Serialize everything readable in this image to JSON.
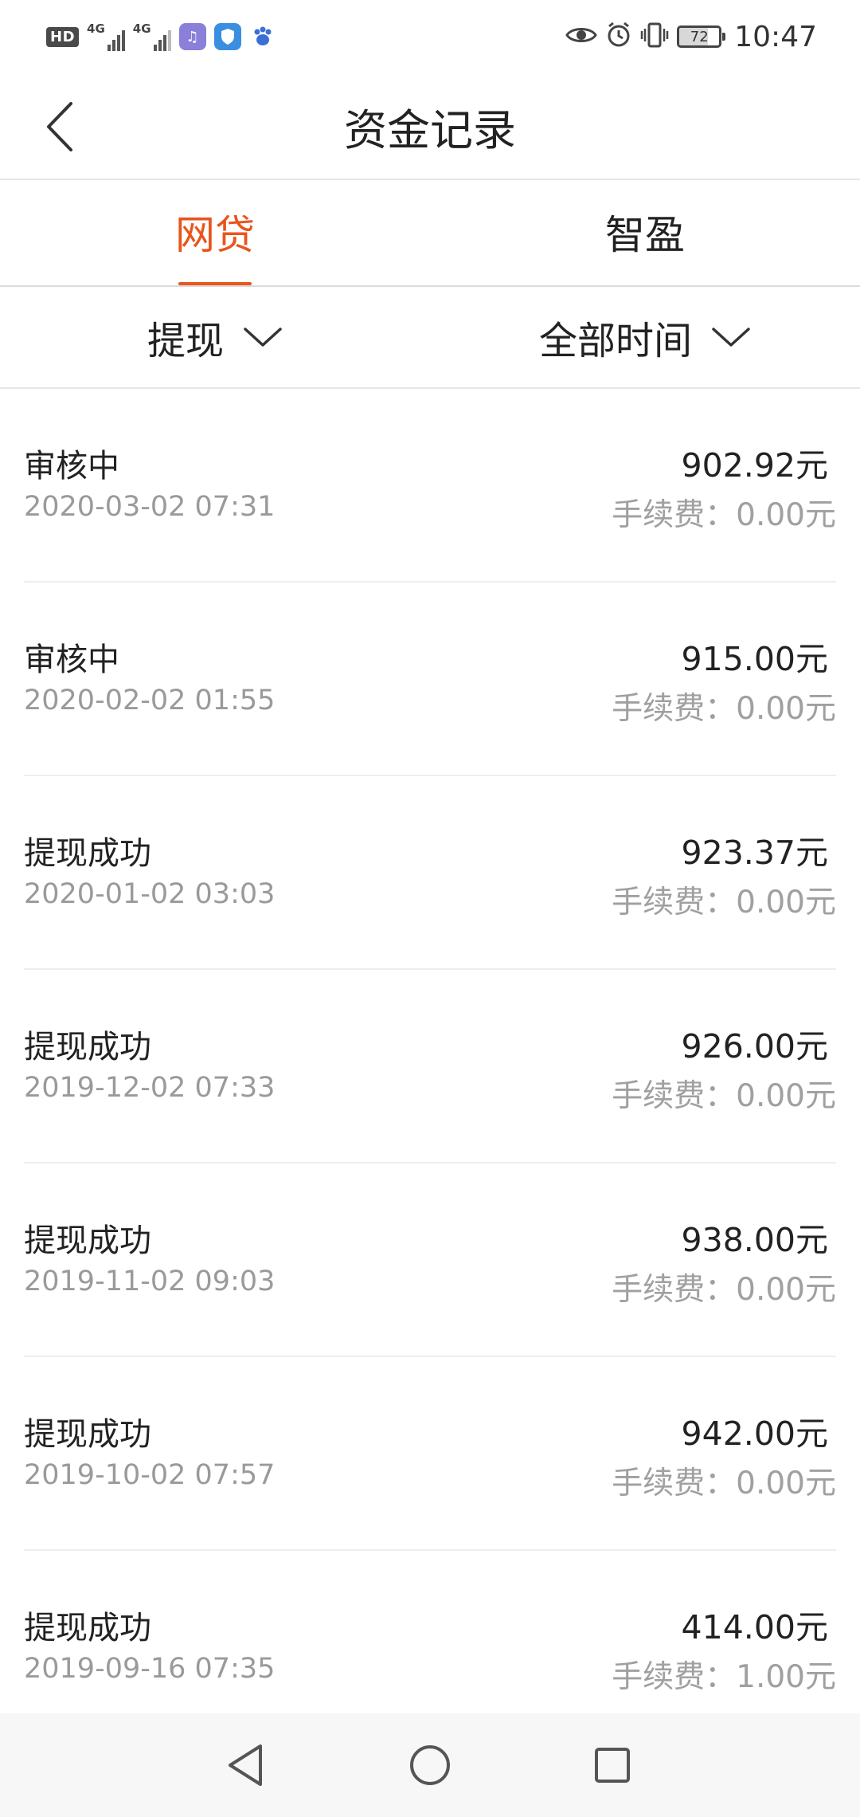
{
  "status_bar": {
    "hd": "HD",
    "net1": "4G",
    "net2": "4G",
    "battery": "72",
    "time": "10:47"
  },
  "header": {
    "title": "资金记录",
    "back_icon": "chevron-left-icon"
  },
  "tabs": [
    {
      "label": "网贷",
      "active": true
    },
    {
      "label": "智盈",
      "active": false
    }
  ],
  "filters": {
    "type": "提现",
    "time": "全部时间"
  },
  "records": [
    {
      "status": "审核中",
      "date": "2020-03-02 07:31",
      "amount": "902.92元",
      "fee": "手续费：0.00元"
    },
    {
      "status": "审核中",
      "date": "2020-02-02 01:55",
      "amount": "915.00元",
      "fee": "手续费：0.00元"
    },
    {
      "status": "提现成功",
      "date": "2020-01-02 03:03",
      "amount": "923.37元",
      "fee": "手续费：0.00元"
    },
    {
      "status": "提现成功",
      "date": "2019-12-02 07:33",
      "amount": "926.00元",
      "fee": "手续费：0.00元"
    },
    {
      "status": "提现成功",
      "date": "2019-11-02 09:03",
      "amount": "938.00元",
      "fee": "手续费：0.00元"
    },
    {
      "status": "提现成功",
      "date": "2019-10-02 07:57",
      "amount": "942.00元",
      "fee": "手续费：0.00元"
    },
    {
      "status": "提现成功",
      "date": "2019-09-16 07:35",
      "amount": "414.00元",
      "fee": "手续费：1.00元"
    }
  ],
  "colors": {
    "accent": "#e8551d",
    "muted_text": "#9a9a9a",
    "divider": "#eeeeee"
  }
}
